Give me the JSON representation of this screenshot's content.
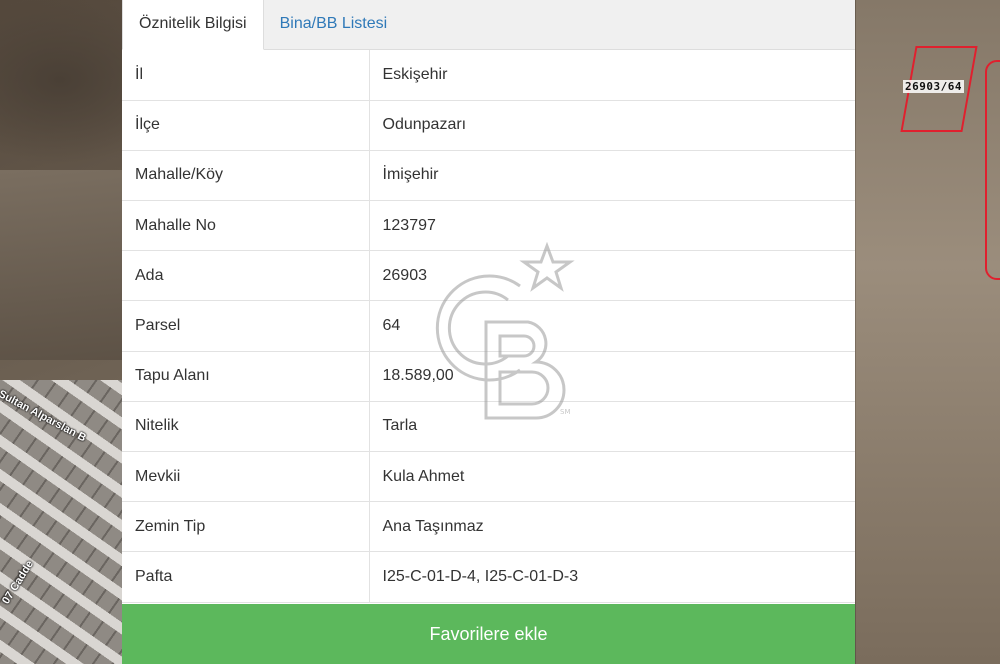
{
  "map": {
    "parcel_label": "26903/64",
    "road_label_1": "Sultan Alparslan B",
    "road_label_2": "07 Cadde",
    "colors": {
      "parcel_outline": "#e0202e"
    }
  },
  "tabs": [
    {
      "label": "Öznitelik Bilgisi",
      "active": true
    },
    {
      "label": "Bina/BB Listesi",
      "active": false
    }
  ],
  "attributes": [
    {
      "key": "İl",
      "value": "Eskişehir"
    },
    {
      "key": "İlçe",
      "value": "Odunpazarı"
    },
    {
      "key": "Mahalle/Köy",
      "value": "İmişehir"
    },
    {
      "key": "Mahalle No",
      "value": "123797"
    },
    {
      "key": "Ada",
      "value": "26903"
    },
    {
      "key": "Parsel",
      "value": "64"
    },
    {
      "key": "Tapu Alanı",
      "value": "18.589,00"
    },
    {
      "key": "Nitelik",
      "value": "Tarla"
    },
    {
      "key": "Mevkii",
      "value": "Kula Ahmet"
    },
    {
      "key": "Zemin Tip",
      "value": "Ana Taşınmaz"
    },
    {
      "key": "Pafta",
      "value": "I25-C-01-D-4, I25-C-01-D-3"
    }
  ],
  "favorite_button": {
    "label": "Favorilere ekle",
    "color": "#5cb85c"
  },
  "watermark": {
    "icon": "coldwell-banker-logo-icon",
    "mark": "SM"
  },
  "colors": {
    "link": "#2f79b8",
    "text": "#333333",
    "border": "#e2e2e2"
  }
}
